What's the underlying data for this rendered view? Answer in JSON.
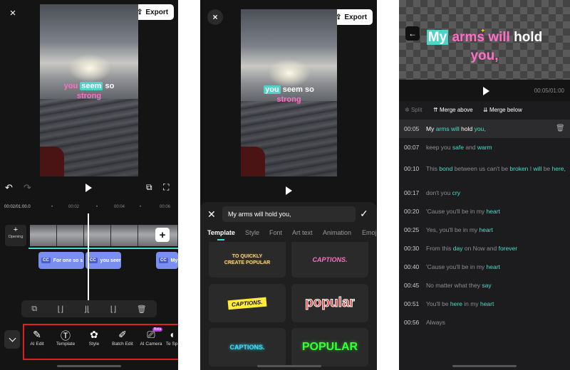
{
  "panel1": {
    "close_icon": "×",
    "export_label": "Export",
    "caption": {
      "w1": "you",
      "w2": "seem",
      "w3": "so",
      "w4": "strong"
    },
    "ruler": [
      "00:02/01:00.0",
      "•",
      "00:02",
      "•",
      "00:04",
      "•",
      "00:06"
    ],
    "opening_plus": "+",
    "opening_label": "Opening",
    "add_clip": "+",
    "clips": [
      "For one so s",
      "you seer",
      "My"
    ],
    "cc_badge": "CC",
    "tools": [
      {
        "icon": "ai-edit-icon",
        "label": "AI Edit"
      },
      {
        "icon": "template-icon",
        "label": "Template"
      },
      {
        "icon": "style-icon",
        "label": "Style"
      },
      {
        "icon": "batch-edit-icon",
        "label": "Batch Edit"
      },
      {
        "icon": "ai-camera-icon",
        "label": "AI Camera",
        "badge": "Beta"
      },
      {
        "icon": "text-speech-icon",
        "label": "Te Sp"
      }
    ]
  },
  "panel2": {
    "close_icon": "×",
    "export_label": "Export",
    "caption": {
      "w1": "you",
      "w2": "seem",
      "w3": "so",
      "w4": "strong"
    },
    "input_value": "My arms will hold you,",
    "tabs": [
      "Template",
      "Style",
      "Font",
      "Art text",
      "Animation",
      "Emoj"
    ],
    "templates": [
      "TO QUICKLY CREATE POPULAR",
      "CAPTIONS.",
      "CAPTIONS.",
      "popular",
      "CAPTIONS.",
      "POPULAR"
    ]
  },
  "panel3": {
    "caption": {
      "w1": "My",
      "w2": "arms",
      "w3": "will",
      "w4": "hold",
      "w5": "you,"
    },
    "time": "00:05/01:00",
    "actions": [
      "Split",
      "Merge above",
      "Merge below"
    ],
    "rows": [
      {
        "time": "00:05",
        "parts": [
          [
            "w",
            "My "
          ],
          [
            "g",
            "arms "
          ],
          [
            "g",
            "will "
          ],
          [
            "w",
            "hold "
          ],
          [
            "g",
            "you,"
          ]
        ]
      },
      {
        "time": "00:07",
        "parts": [
          [
            "n",
            "keep "
          ],
          [
            "n",
            "you "
          ],
          [
            "g",
            "safe "
          ],
          [
            "n",
            "and "
          ],
          [
            "g",
            "warm"
          ]
        ]
      },
      {
        "time": "00:10",
        "parts": [
          [
            "n",
            "This "
          ],
          [
            "g",
            "bond "
          ],
          [
            "n",
            "between us can't be "
          ],
          [
            "g",
            "broken"
          ],
          [
            "n",
            " I "
          ],
          [
            "g",
            "will "
          ],
          [
            "n",
            "be "
          ],
          [
            "g",
            "here,"
          ]
        ]
      },
      {
        "time": "00:17",
        "parts": [
          [
            "n",
            "don't "
          ],
          [
            "n",
            "you "
          ],
          [
            "g",
            "cry"
          ]
        ]
      },
      {
        "time": "00:20",
        "parts": [
          [
            "n",
            "'Cause you'll be in my "
          ],
          [
            "g",
            "heart"
          ]
        ]
      },
      {
        "time": "00:25",
        "parts": [
          [
            "n",
            "Yes, you'll be in my "
          ],
          [
            "g",
            "heart"
          ]
        ]
      },
      {
        "time": "00:30",
        "parts": [
          [
            "n",
            "From this "
          ],
          [
            "g",
            "day "
          ],
          [
            "n",
            "on Now and "
          ],
          [
            "g",
            "forever"
          ]
        ]
      },
      {
        "time": "00:40",
        "parts": [
          [
            "n",
            "'Cause you'll be in my "
          ],
          [
            "g",
            "heart"
          ]
        ]
      },
      {
        "time": "00:45",
        "parts": [
          [
            "n",
            "No matter what they "
          ],
          [
            "g",
            "say"
          ]
        ]
      },
      {
        "time": "00:51",
        "parts": [
          [
            "n",
            "You'll be "
          ],
          [
            "g",
            "here "
          ],
          [
            "n",
            "in my "
          ],
          [
            "g",
            "heart"
          ]
        ]
      },
      {
        "time": "00:56",
        "parts": [
          [
            "n",
            "Always"
          ]
        ]
      }
    ]
  }
}
